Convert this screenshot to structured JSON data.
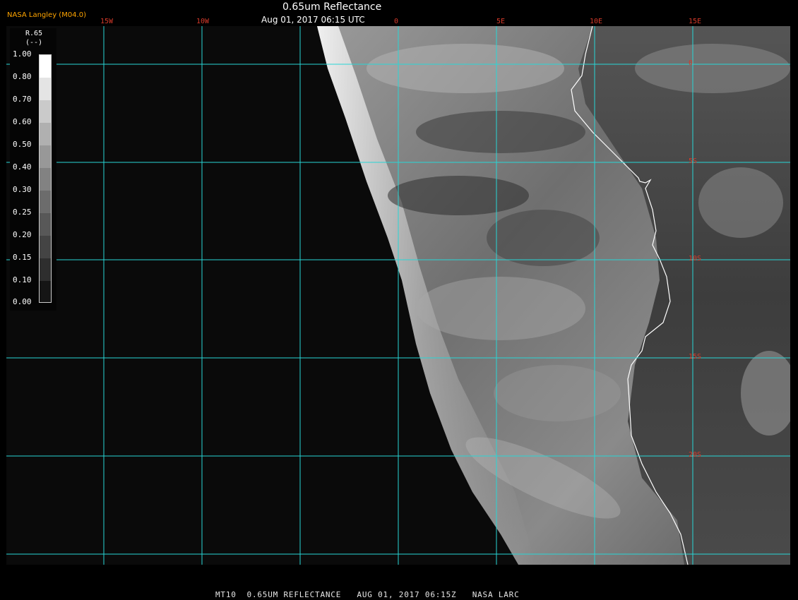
{
  "header": {
    "brand": "NASA Langley (M04.0)",
    "title": "0.65um Reflectance",
    "subtitle": "Aug 01, 2017 06:15 UTC"
  },
  "grid": {
    "lon_labels": [
      "15W",
      "10W",
      "0",
      "5E",
      "10E",
      "15E"
    ],
    "lat_labels": [
      "0",
      "5S",
      "10S",
      "15S",
      "20S"
    ],
    "line_color": "#28d6d6",
    "label_color": "#d63a2a"
  },
  "legend": {
    "title": "R.65",
    "units": "(--)",
    "ticks": [
      "1.00",
      "0.80",
      "0.70",
      "0.60",
      "0.50",
      "0.40",
      "0.30",
      "0.25",
      "0.20",
      "0.15",
      "0.10",
      "0.00"
    ]
  },
  "footer": {
    "text": "MT10  0.65UM REFLECTANCE   AUG 01, 2017 06:15Z   NASA LARC"
  },
  "colors": {
    "background": "#000000",
    "coastline": "#ffffff",
    "brand": "#ffa500"
  }
}
